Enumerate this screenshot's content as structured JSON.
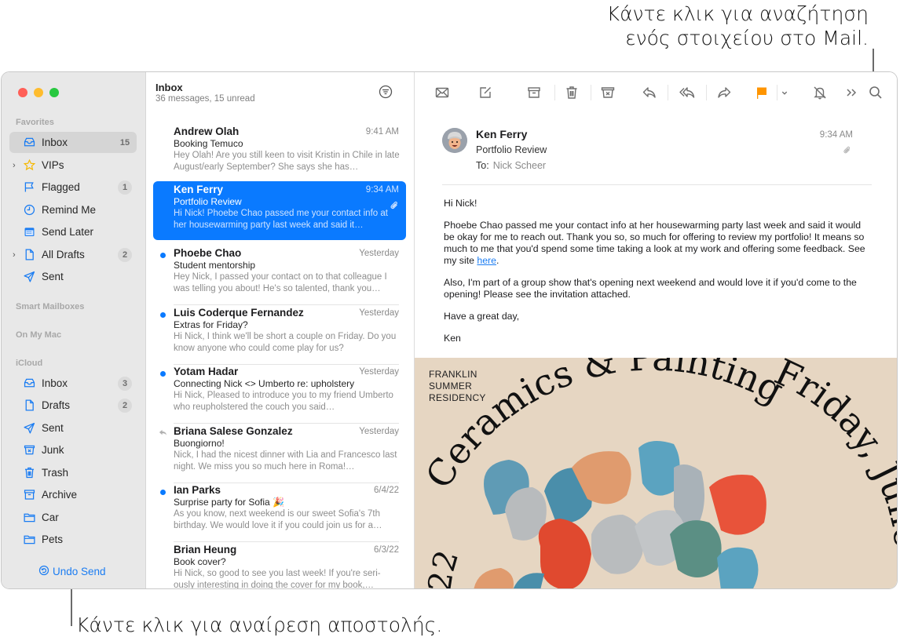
{
  "callouts": {
    "search": "Κάντε κλικ για αναζήτηση\nενός στοιχείου στο Mail.",
    "search_line1": "Κάντε κλικ για αναζήτηση",
    "search_line2": "ενός στοιχείου στο Mail.",
    "undo": "Κάντε κλικ για αναίρεση αποστολής."
  },
  "window_controls": {
    "close": "#ff5f57",
    "minimize": "#febc2e",
    "zoom": "#28c840"
  },
  "sidebar": {
    "sections": {
      "favorites": "Favorites",
      "smart": "Smart Mailboxes",
      "onmac": "On My Mac",
      "icloud": "iCloud"
    },
    "favorites": [
      {
        "label": "Inbox",
        "count": "15",
        "icon": "inbox-icon",
        "selected": true
      },
      {
        "label": "VIPs",
        "count": "",
        "icon": "star-icon",
        "expandable": true
      },
      {
        "label": "Flagged",
        "count": "1",
        "icon": "flag-icon"
      },
      {
        "label": "Remind Me",
        "count": "",
        "icon": "clock-icon"
      },
      {
        "label": "Send Later",
        "count": "",
        "icon": "calendar-icon"
      },
      {
        "label": "All Drafts",
        "count": "2",
        "icon": "document-icon",
        "expandable": true
      },
      {
        "label": "Sent",
        "count": "",
        "icon": "paper-plane-icon"
      }
    ],
    "icloud": [
      {
        "label": "Inbox",
        "count": "3",
        "icon": "inbox-icon"
      },
      {
        "label": "Drafts",
        "count": "2",
        "icon": "document-icon"
      },
      {
        "label": "Sent",
        "count": "",
        "icon": "paper-plane-icon"
      },
      {
        "label": "Junk",
        "count": "",
        "icon": "junk-icon"
      },
      {
        "label": "Trash",
        "count": "",
        "icon": "trash-icon"
      },
      {
        "label": "Archive",
        "count": "",
        "icon": "archive-icon"
      },
      {
        "label": "Car",
        "count": "",
        "icon": "folder-icon"
      },
      {
        "label": "Pets",
        "count": "",
        "icon": "folder-icon"
      }
    ],
    "undo_send": "Undo Send"
  },
  "message_list": {
    "title": "Inbox",
    "subtitle": "36 messages, 15 unread",
    "messages": [
      {
        "from": "Andrew Olah",
        "time": "9:41 AM",
        "subject": "Booking Temuco",
        "preview": "Hey Olah! Are you still keen to visit Kristin in Chile in late August/early September? She says she has…",
        "unread": false,
        "replied": false,
        "attachment": false,
        "selected": false
      },
      {
        "from": "Ken Ferry",
        "time": "9:34 AM",
        "subject": "Portfolio Review",
        "preview": "Hi Nick! Phoebe Chao passed me your contact info at her housewarming party last week and said it…",
        "unread": false,
        "replied": false,
        "attachment": true,
        "selected": true
      },
      {
        "from": "Phoebe Chao",
        "time": "Yesterday",
        "subject": "Student mentorship",
        "preview": "Hey Nick, I passed your contact on to that colleague I was telling you about! He's so talented, thank you…",
        "unread": true,
        "replied": false,
        "attachment": false,
        "selected": false
      },
      {
        "from": "Luis Coderque Fernandez",
        "time": "Yesterday",
        "subject": "Extras for Friday?",
        "preview": "Hi Nick, I think we'll be short a couple on Friday. Do you know anyone who could come play for us?",
        "unread": true,
        "replied": false,
        "attachment": false,
        "selected": false
      },
      {
        "from": "Yotam Hadar",
        "time": "Yesterday",
        "subject": "Connecting Nick <> Umberto re: upholstery",
        "preview": "Hi Nick, Pleased to introduce you to my friend Umberto who reupholstered the couch you said…",
        "unread": true,
        "replied": false,
        "attachment": false,
        "selected": false
      },
      {
        "from": "Briana Salese Gonzalez",
        "time": "Yesterday",
        "subject": "Buongiorno!",
        "preview": "Nick, I had the nicest dinner with Lia and Francesco last night. We miss you so much here in Roma!…",
        "unread": false,
        "replied": true,
        "attachment": false,
        "selected": false
      },
      {
        "from": "Ian Parks",
        "time": "6/4/22",
        "subject": "Surprise party for Sofia 🎉",
        "preview": "As you know, next weekend is our sweet Sofia's 7th birthday. We would love it if you could join us for a…",
        "unread": true,
        "replied": false,
        "attachment": false,
        "selected": false
      },
      {
        "from": "Brian Heung",
        "time": "6/3/22",
        "subject": "Book cover?",
        "preview": "Hi Nick, so good to see you last week! If you're seri-ously interesting in doing the cover for my book,…",
        "unread": false,
        "replied": false,
        "attachment": false,
        "selected": false
      }
    ]
  },
  "toolbar": {
    "buttons": [
      {
        "name": "get-mail",
        "icon": "envelope-icon"
      },
      {
        "name": "compose",
        "icon": "compose-icon"
      },
      {
        "name": "archive",
        "icon": "archive-icon"
      },
      {
        "name": "delete",
        "icon": "trash-icon"
      },
      {
        "name": "junk",
        "icon": "junk-icon"
      },
      {
        "name": "reply",
        "icon": "reply-icon"
      },
      {
        "name": "reply-all",
        "icon": "reply-all-icon"
      },
      {
        "name": "forward",
        "icon": "forward-icon"
      },
      {
        "name": "flag",
        "icon": "flag-icon"
      },
      {
        "name": "flag-menu",
        "icon": "chevron-down-icon"
      },
      {
        "name": "mute",
        "icon": "bell-slash-icon"
      },
      {
        "name": "more",
        "icon": "chevron-double-right-icon"
      },
      {
        "name": "search",
        "icon": "search-icon"
      }
    ],
    "flag_color": "#ff9500"
  },
  "reader": {
    "from": "Ken Ferry",
    "subject": "Portfolio Review",
    "to_label": "To:",
    "to": "Nick Scheer",
    "time": "9:34 AM",
    "has_attachment": true,
    "body": {
      "greeting": "Hi Nick!",
      "p1_before_link": "Phoebe Chao passed me your contact info at her housewarming party last week and said it would be okay for me to reach out. Thank you so, so much for offering to review my portfolio! It means so much to me that you'd spend some time taking a look at my work and offering some feedback. See my site ",
      "p1_link": "here",
      "p1_after_link": ".",
      "p2": "Also, I'm part of a group show that's opening next weekend and would love it if you'd come to the opening! Please see the invitation attached.",
      "closing": "Have a great day,",
      "signature": "Ken"
    },
    "invitation": {
      "organization": "FRANKLIN\nSUMMER\nRESIDENCY",
      "title": "Ceramics & Painting",
      "date": "Friday, June",
      "year_fragment": "22"
    }
  },
  "colors": {
    "accent": "#0a7aff",
    "sidebar_icon": "#1a7cf2",
    "vip_star": "#f5b800"
  }
}
